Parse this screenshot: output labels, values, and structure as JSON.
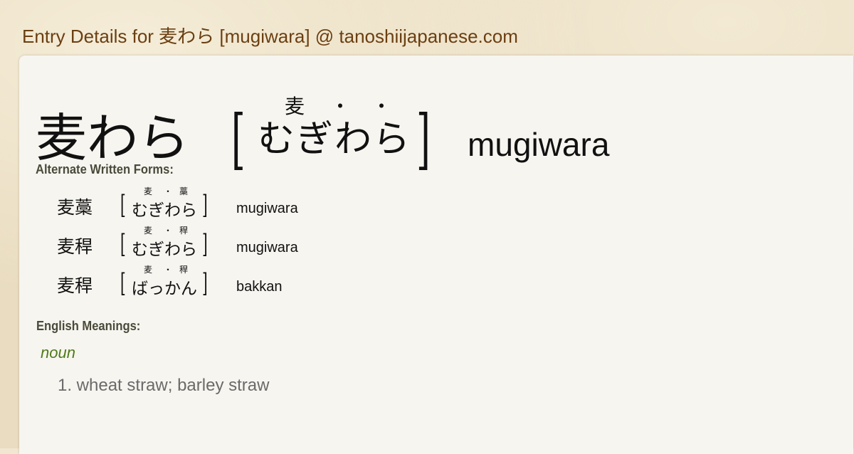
{
  "site_title": "Entry Details for 麦わら [mugiwara] @ tanoshiijapanese.com",
  "entry": {
    "word": "麦わら",
    "reading": "むぎわら",
    "ruby": [
      "麦",
      "・",
      "・"
    ],
    "open_bracket": "[",
    "close_bracket": "]",
    "romaji": "mugiwara"
  },
  "alternate": {
    "label": "Alternate Written Forms:",
    "forms": [
      {
        "kanji": "麦藁",
        "reading": "むぎわら",
        "ruby": [
          "麦",
          "・",
          "藁"
        ],
        "romaji": "mugiwara"
      },
      {
        "kanji": "麦稈",
        "reading": "むぎわら",
        "ruby": [
          "麦",
          "・",
          "稈"
        ],
        "romaji": "mugiwara"
      },
      {
        "kanji": "麦稈",
        "reading": "ばっかん",
        "ruby": [
          "麦",
          "・",
          "稈"
        ],
        "romaji": "bakkan"
      }
    ]
  },
  "meanings": {
    "label": "English Meanings:",
    "part_of_speech": "noun",
    "items": [
      "1. wheat straw; barley straw"
    ]
  }
}
